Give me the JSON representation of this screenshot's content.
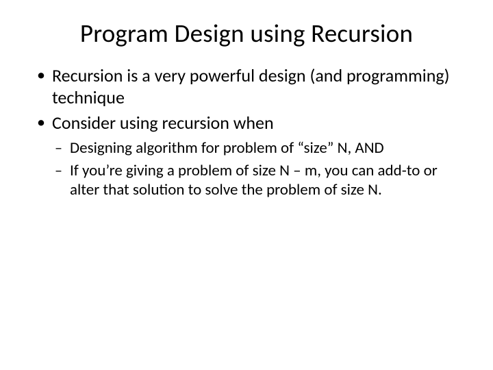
{
  "title": "Program Design using Recursion",
  "bullets": [
    {
      "text": "Recursion is a very powerful design (and programming) technique"
    },
    {
      "text": "Consider using recursion when",
      "sub": [
        "Designing algorithm for problem of “size” N, AND",
        "If you’re giving a problem of size N – m, you can add-to or alter that solution to solve the problem of size N."
      ]
    }
  ]
}
